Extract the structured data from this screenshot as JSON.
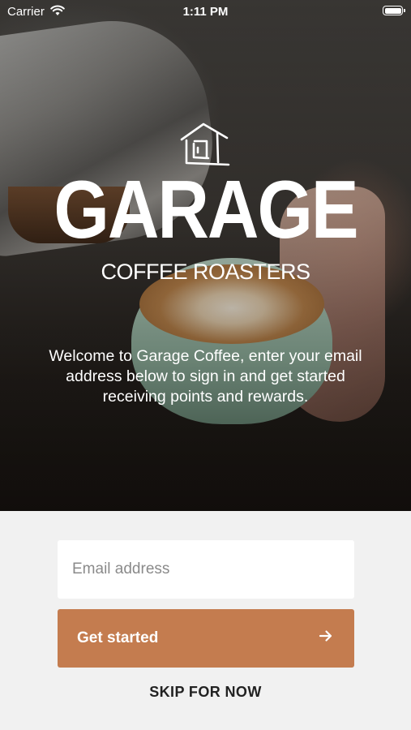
{
  "status_bar": {
    "carrier": "Carrier",
    "time": "1:11 PM"
  },
  "brand": {
    "name": "GARAGE",
    "subtitle": "COFFEE ROASTERS"
  },
  "welcome_text": "Welcome to Garage Coffee, enter your email address below to sign in and get started receiving points and rewards.",
  "form": {
    "email_placeholder": "Email address",
    "email_value": "",
    "submit_label": "Get started",
    "skip_label": "SKIP FOR NOW"
  },
  "colors": {
    "accent": "#c47c4f",
    "form_background": "#f1f1f1"
  },
  "icons": {
    "logo": "garage-house-icon",
    "submit": "arrow-right-icon",
    "wifi": "wifi-icon",
    "battery": "battery-icon"
  }
}
